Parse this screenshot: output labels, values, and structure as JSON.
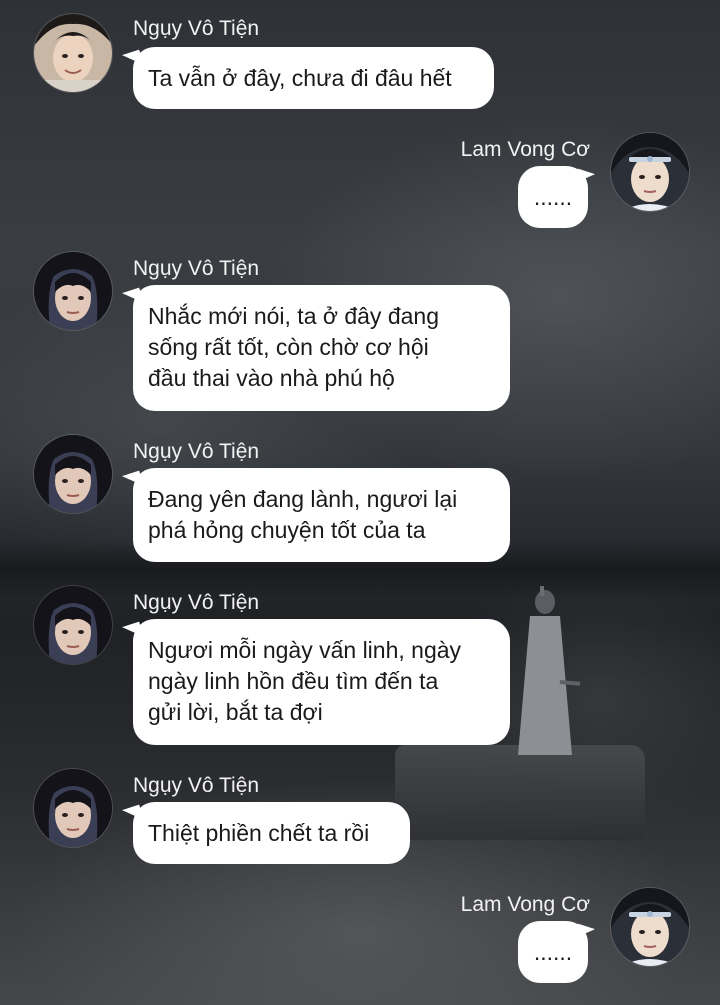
{
  "messages": [
    {
      "sender": "Ngụy Vô Tiện",
      "side": "left",
      "lines": [
        "Ta vẫn ở đây, chưa đi đâu hết"
      ],
      "avatar": "wei-wuxian-avatar"
    },
    {
      "sender": "Lam Vong Cơ",
      "side": "right",
      "lines": [
        "......"
      ],
      "avatar": "lan-wangji-avatar"
    },
    {
      "sender": "Ngụy Vô Tiện",
      "side": "left",
      "lines": [
        "Nhắc mới nói, ta ở đây đang",
        "sống rất tốt, còn chờ cơ hội",
        "đầu thai vào nhà phú hộ"
      ],
      "avatar": "wei-wuxian-avatar"
    },
    {
      "sender": "Ngụy Vô Tiện",
      "side": "left",
      "lines": [
        "Đang yên đang lành, ngươi lại",
        "phá hỏng chuyện tốt của ta"
      ],
      "avatar": "wei-wuxian-avatar"
    },
    {
      "sender": "Ngụy Vô Tiện",
      "side": "left",
      "lines": [
        "Ngươi mỗi ngày vấn linh, ngày",
        "ngày linh hồn đều tìm đến ta",
        "gửi lời, bắt ta đợi"
      ],
      "avatar": "wei-wuxian-avatar"
    },
    {
      "sender": "Ngụy Vô Tiện",
      "side": "left",
      "lines": [
        "Thiệt phiền chết ta rồi"
      ],
      "avatar": "wei-wuxian-avatar"
    },
    {
      "sender": "Lam Vong Cơ",
      "side": "right",
      "lines": [
        "......"
      ],
      "avatar": "lan-wangji-avatar"
    }
  ],
  "colors": {
    "bubble": "#ffffff",
    "text": "#1a1a1a",
    "name": "#f2f2f2",
    "background": "#2b2e33"
  }
}
